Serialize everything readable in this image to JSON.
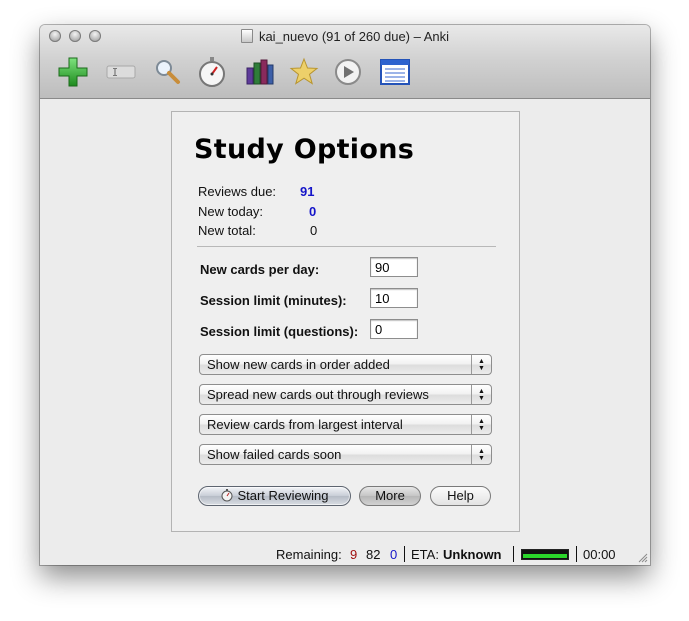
{
  "window": {
    "title": "kai_nuevo (91 of 260 due) – Anki"
  },
  "toolbar": {
    "items": [
      {
        "name": "add-icon",
        "color": "#2aa32a"
      },
      {
        "name": "edit-icon",
        "color": "#c7c7c7"
      },
      {
        "name": "search-icon",
        "color": "#bfd3e6"
      },
      {
        "name": "stopwatch-icon",
        "color": "#cfcfcf"
      },
      {
        "name": "graphs-icon",
        "color": "#6b3aa8"
      },
      {
        "name": "star-icon",
        "color": "#e6c35a"
      },
      {
        "name": "play-icon",
        "color": "#8c8c8c"
      },
      {
        "name": "card-list-icon",
        "color": "#2a5cc4"
      }
    ]
  },
  "study": {
    "heading": "Study Options",
    "reviews_due_label": "Reviews due:",
    "reviews_due_value": "91",
    "new_today_label": "New today:",
    "new_today_value": "0",
    "new_total_label": "New total:",
    "new_total_value": "0",
    "value_color": "#1515c9",
    "new_cards_per_day_label": "New cards per day:",
    "new_cards_per_day_value": "90",
    "session_limit_minutes_label": "Session limit (minutes):",
    "session_limit_minutes_value": "10",
    "session_limit_questions_label": "Session limit (questions):",
    "session_limit_questions_value": "0",
    "selects": [
      "Show new cards in order added",
      "Spread new cards out through reviews",
      "Review cards from largest interval",
      "Show failed cards soon"
    ],
    "start_button": "Start Reviewing",
    "more_button": "More",
    "help_button": "Help"
  },
  "status": {
    "remaining_label": "Remaining:",
    "remaining_failed": "9",
    "remaining_review": "82",
    "remaining_new": "0",
    "eta_label": "ETA:",
    "eta_value": "Unknown",
    "progress_fraction": 1.0,
    "time": "00:00",
    "colors": {
      "failed": "#a01010",
      "new": "#1515c9",
      "progress": "#2bd62b"
    }
  }
}
